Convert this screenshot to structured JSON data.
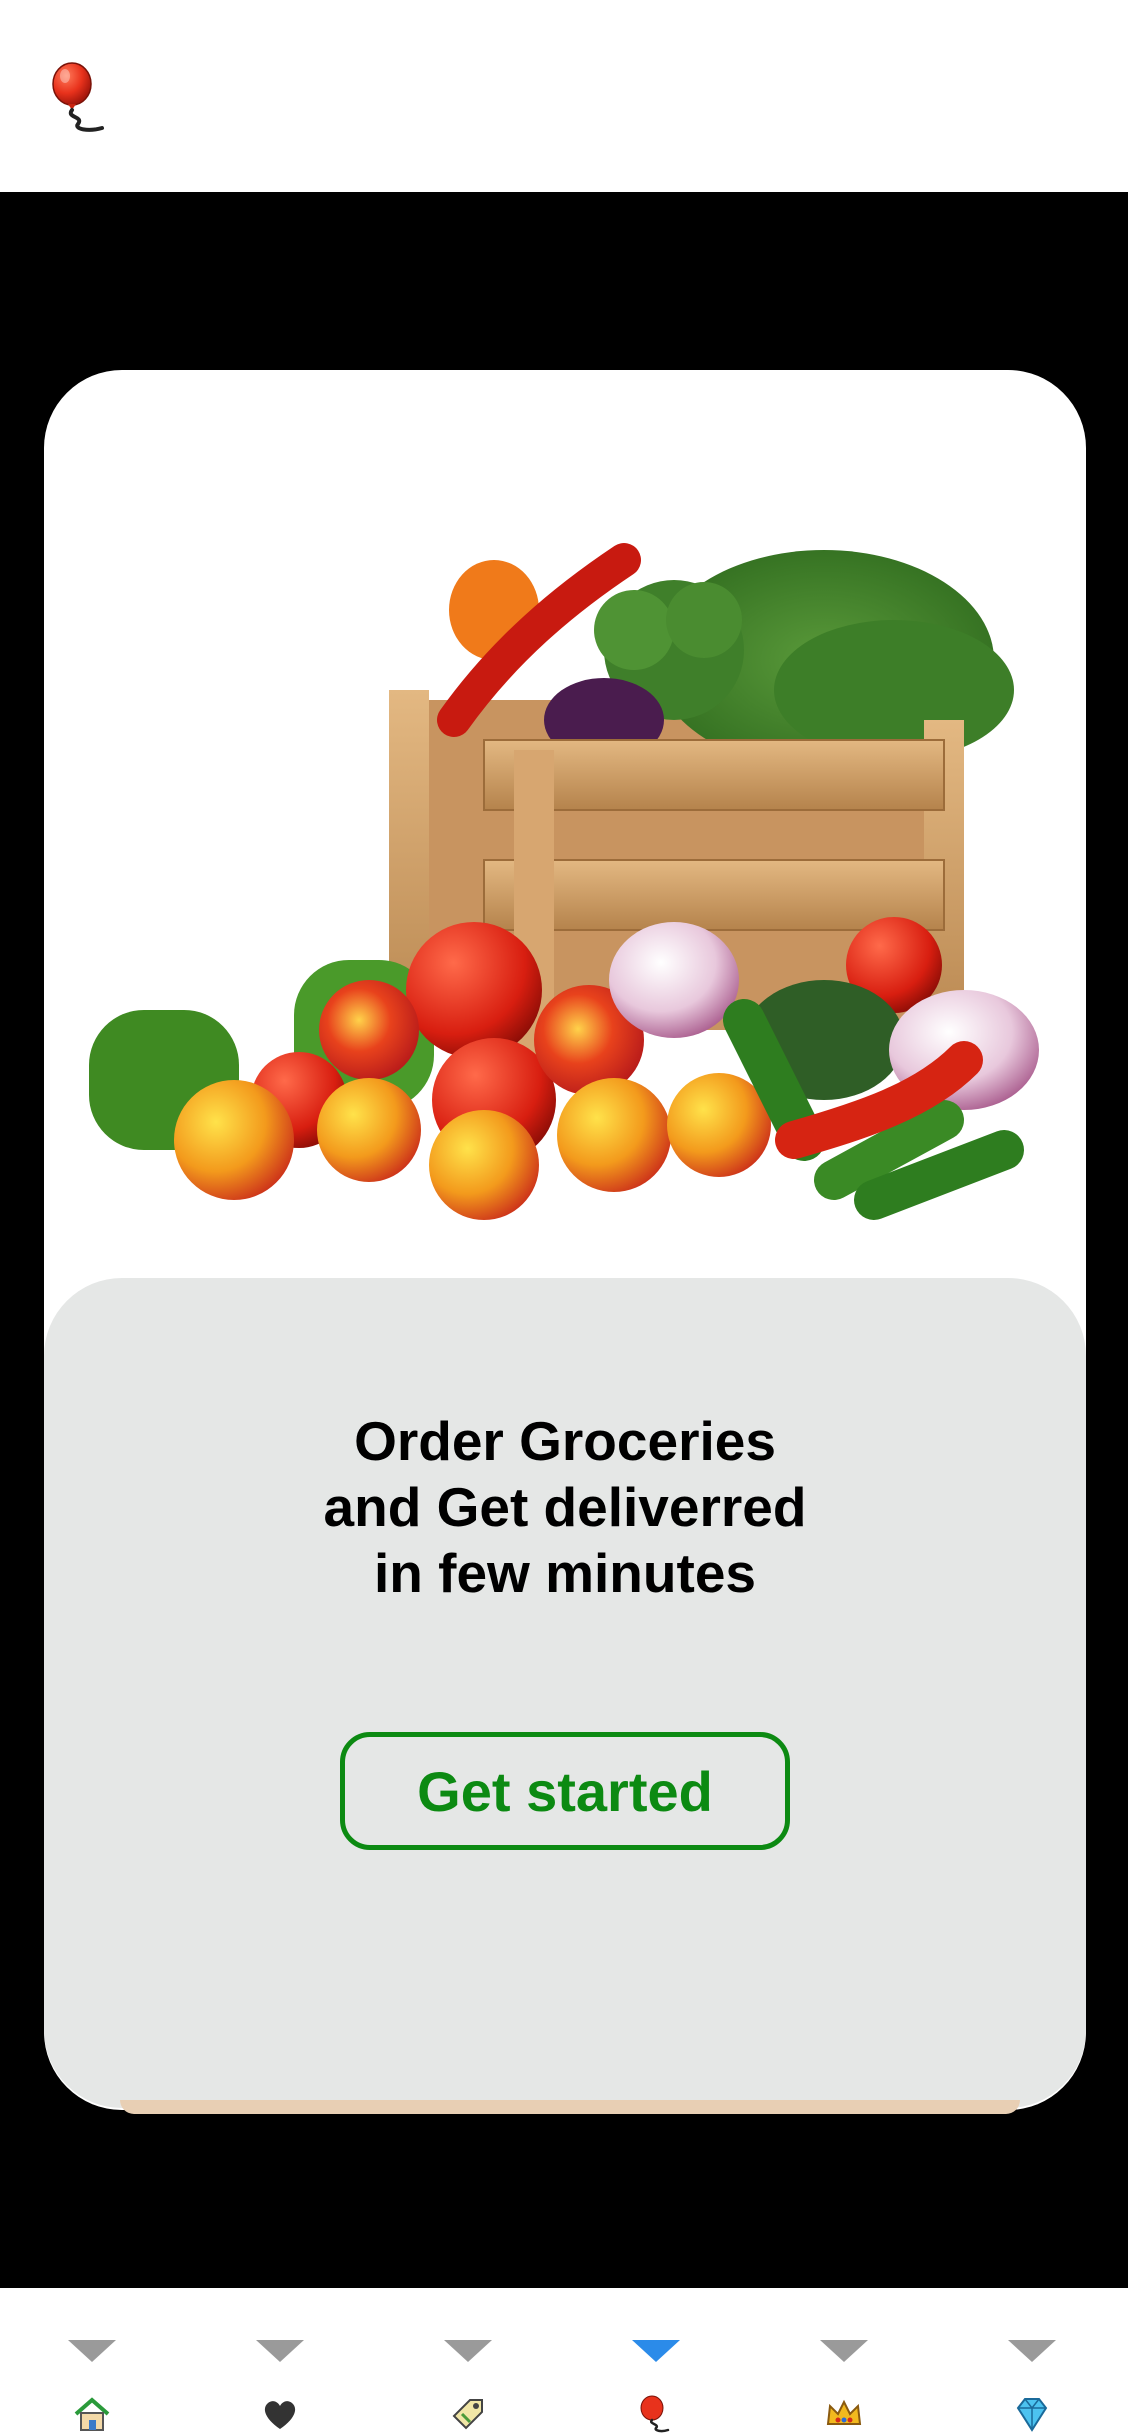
{
  "app": {
    "logo_icon": "balloon-icon"
  },
  "onboarding": {
    "hero_image": "fresh-vegetables-in-wooden-crate",
    "headline_lines": [
      "Order Groceries",
      "and Get deliverred",
      "in few minutes"
    ],
    "cta_label": "Get started"
  },
  "colors": {
    "accent": "#0c8a12",
    "nav_active": "#2b8be9",
    "nav_inactive": "#9a9a9a",
    "panel_bg": "#e5e7e6",
    "stage_bg": "#000000"
  },
  "bottom_nav": {
    "active_index": 3,
    "items": [
      {
        "icon": "house-icon"
      },
      {
        "icon": "heart-icon"
      },
      {
        "icon": "tag-icon"
      },
      {
        "icon": "balloon-icon"
      },
      {
        "icon": "crown-icon"
      },
      {
        "icon": "gem-icon"
      }
    ]
  }
}
